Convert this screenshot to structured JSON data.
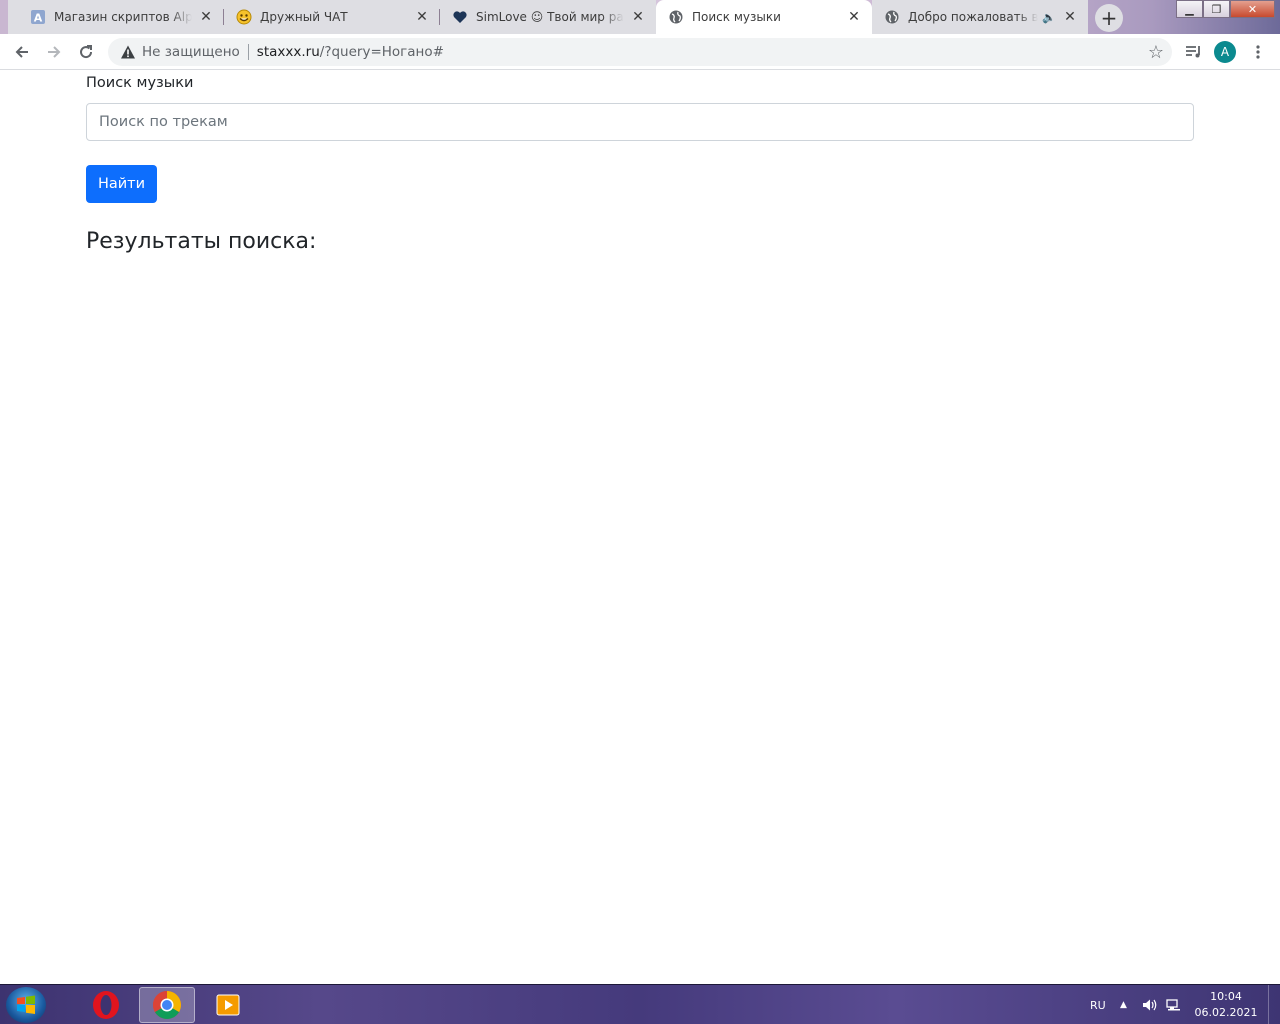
{
  "browser": {
    "tabs": [
      {
        "title": "Магазин скриптов AlphaCMS",
        "favicon": "alphacms-a-icon",
        "active": false
      },
      {
        "title": "Дружный ЧАТ",
        "favicon": "smiley-icon",
        "active": false
      },
      {
        "title": "SimLove ☺ Твой мир развлечений",
        "favicon": "heart-icon",
        "active": false
      },
      {
        "title": "Поиск музыки",
        "favicon": "globe-icon",
        "active": true
      },
      {
        "title": "Добро пожаловать в мир",
        "favicon": "globe-icon",
        "active": false,
        "audio": true
      }
    ],
    "new_tab": "+",
    "security_text": "Не защищено",
    "url_host": "staxxx.ru",
    "url_rest": "/?query=Ногано#",
    "profile_initial": "A"
  },
  "page": {
    "label": "Поиск музыки",
    "search_placeholder": "Поиск по трекам",
    "search_value": "",
    "search_button": "Найти",
    "results_heading": "Результаты поиска:"
  },
  "taskbar": {
    "language": "RU",
    "time": "10:04",
    "date": "06.02.2021"
  },
  "colors": {
    "primary_button": "#0d6efd",
    "avatar": "#0b8a8f"
  }
}
